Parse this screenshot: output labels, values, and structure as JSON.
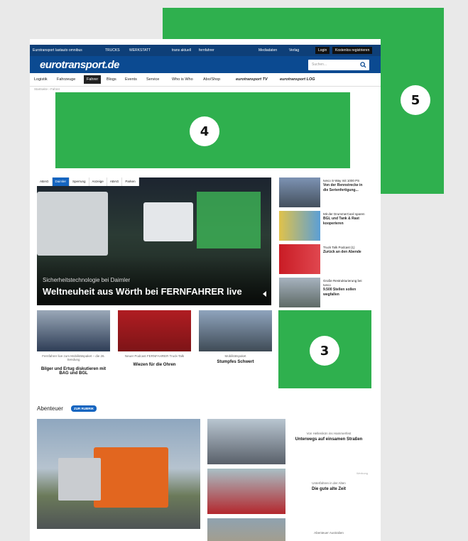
{
  "topbar": {
    "links": [
      "Eurotransport",
      "lastauto omnibus",
      "TRUCKS",
      "WERKSTATT",
      "trans aktuell",
      "fernfahrer"
    ],
    "mediadaten": "Mediadaten",
    "verlag": "Verlag",
    "login": "Login",
    "register": "Kostenlos registrieren"
  },
  "header": {
    "logo": "eurotransport.de",
    "search_placeholder": "Suchen..."
  },
  "nav": {
    "items": [
      "Logistik",
      "Fahrzeuge",
      "Fahrer",
      "Blogs",
      "Events",
      "Service",
      "Who is Who",
      "Abo/Shop",
      "eurotransport TV",
      "eurotransport LOG"
    ],
    "active": "Fahrer"
  },
  "breadcrumb": "Startseite  ›  Fahrer",
  "overlays": {
    "badge_3": "3",
    "badge_4": "4",
    "badge_5": "5"
  },
  "hero": {
    "tabs": [
      "ABAG",
      "Daimler",
      "Sperrung",
      "Anzeige",
      "ABAG",
      "Parken"
    ],
    "active_tab": "Daimler",
    "subtitle": "Sicherheitstechnologie bei Daimler",
    "title": "Weltneuheit aus Wörth bei FERNFAHRER live"
  },
  "side_news": [
    {
      "kicker": "Iveco S-Way mit 1000 PS",
      "title": "Von der Rennstrecke in die Serienfertigung..."
    },
    {
      "kicker": "Mit der DrummerCard sparen",
      "title": "BGL und Tank & Rast kooperieren"
    },
    {
      "kicker": "Truck Talk Podcast (1)",
      "title": "Zurück an den Abende"
    },
    {
      "kicker": "Große Restrukturierung bei Iveco",
      "title": "9.500 Stellen sollen wegfallen"
    }
  ],
  "cards": [
    {
      "kicker": "Fernfahrer live zum Mobilitätspaket – die 26. Sendung",
      "title": "Bilger und Ertug diskutieren mit BAG und BGL"
    },
    {
      "kicker": "Neuer Podcast FERNFAHRER Truck-Talk",
      "title": "Wiezen für die Ohren"
    },
    {
      "kicker": "Mobilitätspaket",
      "title": "Stumpfes Schwert"
    }
  ],
  "section": {
    "label": "Abenteuer",
    "button": "ZUR RUBRIK"
  },
  "stories": [
    {
      "kicker": "Von Hellenikön ins Hammerfest",
      "title": "Unterwegs auf einsamen Straßen",
      "ad": ""
    },
    {
      "kicker": "Unterfahren in der Alten",
      "title": "Die gute alte Zeit",
      "ad": "Werbung"
    },
    {
      "kicker": "Abenteuer Australien",
      "title": "",
      "ad": ""
    }
  ]
}
